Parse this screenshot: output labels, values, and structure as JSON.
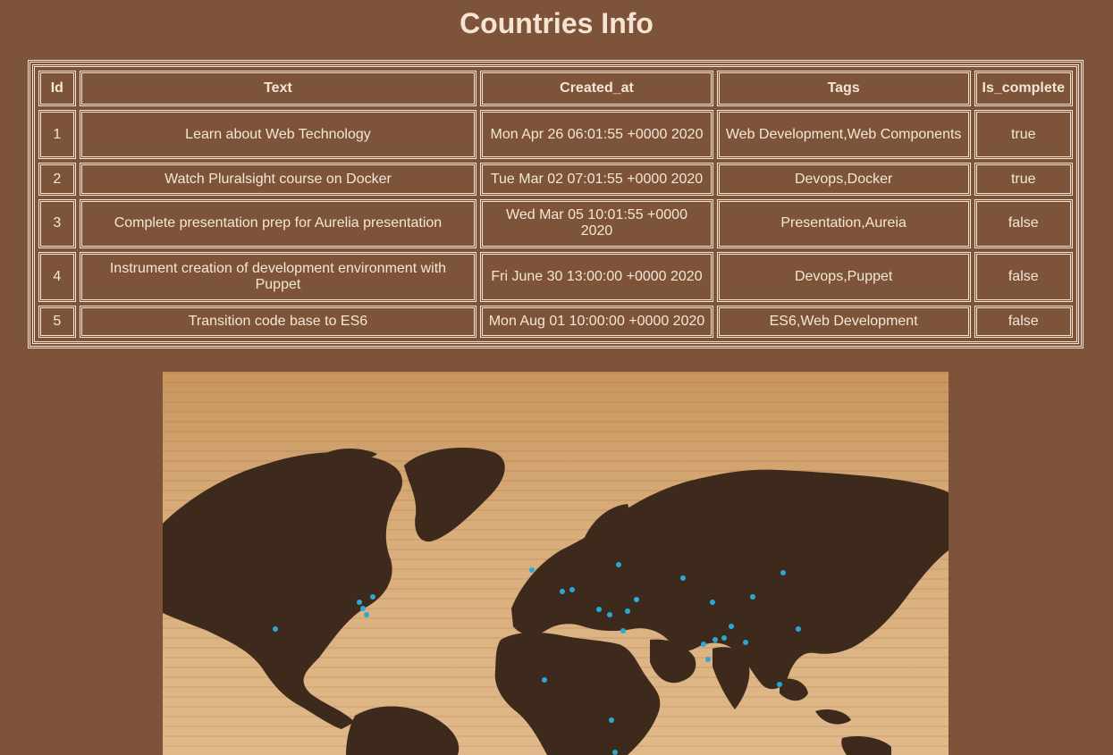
{
  "page": {
    "title": "Countries Info"
  },
  "table": {
    "headers": [
      "Id",
      "Text",
      "Created_at",
      "Tags",
      "Is_complete"
    ],
    "rows": [
      [
        "1",
        "Learn about Web Technology",
        "Mon Apr 26 06:01:55 +0000 2020",
        "Web Development,Web Components",
        "true"
      ],
      [
        "2",
        "Watch Pluralsight course on Docker",
        "Tue Mar 02 07:01:55 +0000 2020",
        "Devops,Docker",
        "true"
      ],
      [
        "3",
        "Complete presentation prep for Aurelia presentation",
        "Wed Mar 05 10:01:55 +0000 2020",
        "Presentation,Aureia",
        "false"
      ],
      [
        "4",
        "Instrument creation of development environment with Puppet",
        "Fri June 30 13:00:00 +0000 2020",
        "Devops,Puppet",
        "false"
      ],
      [
        "5",
        "Transition code base to ES6",
        "Mon Aug 01 10:00:00 +0000 2020",
        "ES6,Web Development",
        "false"
      ]
    ]
  },
  "image": {
    "subject": "wooden-world-map-with-pins",
    "colors": {
      "wood": "#d9ad7a",
      "land": "#3e2a1c",
      "pin": "#2aa9d8"
    }
  }
}
